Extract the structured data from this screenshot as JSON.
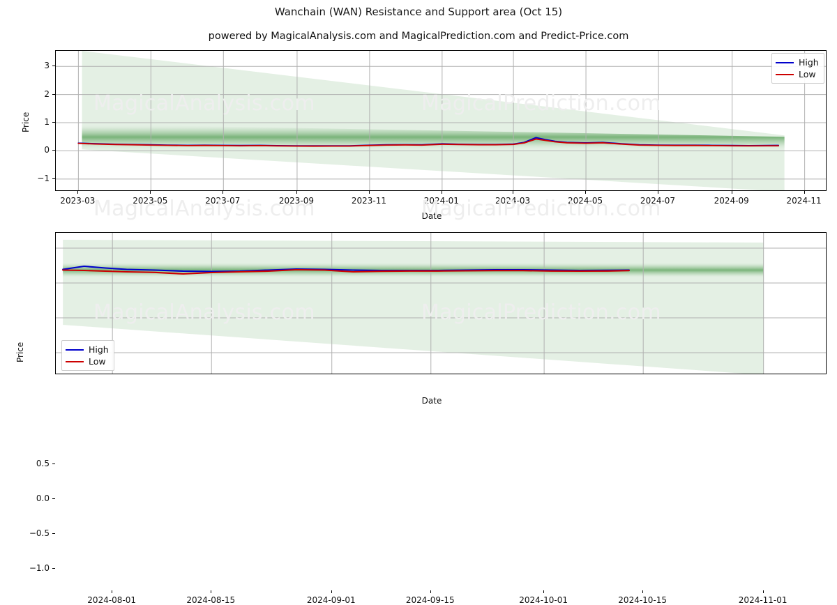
{
  "title": "Wanchain (WAN) Resistance and Support area (Oct 15)",
  "subtitle": "powered by MagicalAnalysis.com and MagicalPrediction.com and Predict-Price.com",
  "watermarks": [
    "MagicalAnalysis.com",
    "MagicalPrediction.com"
  ],
  "colors": {
    "high": "#0000cc",
    "low": "#cc0000",
    "band_core": "#6aab6a",
    "band_outer": "#e3efe3",
    "grid": "#b0b0b0",
    "axis": "#000000",
    "watermark": "#eeeeee"
  },
  "chart_data": [
    {
      "type": "line",
      "id": "top-panel",
      "title": "Wanchain (WAN) Resistance and Support area (Oct 15)",
      "xlabel": "Date",
      "ylabel": "Price",
      "grid": true,
      "legend_position": "upper right",
      "xticks": [
        "2023-03",
        "2023-05",
        "2023-07",
        "2023-09",
        "2023-11",
        "2024-01",
        "2024-03",
        "2024-05",
        "2024-07",
        "2024-09",
        "2024-11"
      ],
      "yticks": [
        3,
        2,
        1,
        0,
        -1
      ],
      "ylim": [
        -1.45,
        3.55
      ],
      "xlim": [
        "2023-02-10",
        "2024-11-20"
      ],
      "legend": [
        "High",
        "Low"
      ],
      "series": [
        {
          "name": "High",
          "color": "#0000cc",
          "x": [
            "2023-03-01",
            "2023-03-15",
            "2023-04-01",
            "2023-04-15",
            "2023-05-01",
            "2023-05-15",
            "2023-06-01",
            "2023-06-15",
            "2023-07-01",
            "2023-07-15",
            "2023-08-01",
            "2023-08-15",
            "2023-09-01",
            "2023-09-15",
            "2023-10-01",
            "2023-10-15",
            "2023-11-01",
            "2023-11-15",
            "2023-12-01",
            "2023-12-15",
            "2024-01-01",
            "2024-01-15",
            "2024-02-01",
            "2024-02-15",
            "2024-03-01",
            "2024-03-10",
            "2024-03-20",
            "2024-03-28",
            "2024-04-05",
            "2024-04-15",
            "2024-05-01",
            "2024-05-15",
            "2024-06-01",
            "2024-06-15",
            "2024-07-01",
            "2024-07-15",
            "2024-08-01",
            "2024-08-15",
            "2024-09-01",
            "2024-09-15",
            "2024-10-01",
            "2024-10-10"
          ],
          "values": [
            0.275,
            0.255,
            0.235,
            0.225,
            0.215,
            0.205,
            0.195,
            0.2,
            0.195,
            0.19,
            0.195,
            0.185,
            0.18,
            0.178,
            0.18,
            0.18,
            0.2,
            0.215,
            0.22,
            0.215,
            0.25,
            0.235,
            0.225,
            0.225,
            0.24,
            0.3,
            0.47,
            0.4,
            0.34,
            0.3,
            0.285,
            0.3,
            0.25,
            0.215,
            0.205,
            0.2,
            0.2,
            0.195,
            0.19,
            0.185,
            0.19,
            0.195
          ]
        },
        {
          "name": "Low",
          "color": "#cc0000",
          "x": [
            "2023-03-01",
            "2023-03-15",
            "2023-04-01",
            "2023-04-15",
            "2023-05-01",
            "2023-05-15",
            "2023-06-01",
            "2023-06-15",
            "2023-07-01",
            "2023-07-15",
            "2023-08-01",
            "2023-08-15",
            "2023-09-01",
            "2023-09-15",
            "2023-10-01",
            "2023-10-15",
            "2023-11-01",
            "2023-11-15",
            "2023-12-01",
            "2023-12-15",
            "2024-01-01",
            "2024-01-15",
            "2024-02-01",
            "2024-02-15",
            "2024-03-01",
            "2024-03-10",
            "2024-03-20",
            "2024-03-28",
            "2024-04-05",
            "2024-04-15",
            "2024-05-01",
            "2024-05-15",
            "2024-06-01",
            "2024-06-15",
            "2024-07-01",
            "2024-07-15",
            "2024-08-01",
            "2024-08-15",
            "2024-09-01",
            "2024-09-15",
            "2024-10-01",
            "2024-10-10"
          ],
          "values": [
            0.265,
            0.245,
            0.225,
            0.215,
            0.205,
            0.195,
            0.185,
            0.19,
            0.185,
            0.18,
            0.185,
            0.175,
            0.17,
            0.168,
            0.17,
            0.17,
            0.19,
            0.205,
            0.21,
            0.205,
            0.235,
            0.225,
            0.215,
            0.215,
            0.228,
            0.28,
            0.42,
            0.37,
            0.32,
            0.285,
            0.27,
            0.285,
            0.238,
            0.205,
            0.195,
            0.19,
            0.19,
            0.185,
            0.18,
            0.175,
            0.18,
            0.18
          ]
        }
      ],
      "bands": {
        "description": "Resistance/support cone widening to the right",
        "outer_start": {
          "upper": 3.55,
          "lower": 0.05
        },
        "outer_end": {
          "upper": 0.55,
          "lower": -1.45
        },
        "core_start": {
          "upper": 0.95,
          "lower": 0.05
        },
        "core_end": {
          "upper": 0.5,
          "lower": 0.02
        }
      }
    },
    {
      "type": "line",
      "id": "bottom-panel",
      "xlabel": "Date",
      "ylabel": "Price",
      "grid": true,
      "legend_position": "lower left",
      "xticks": [
        "2024-08-01",
        "2024-08-15",
        "2024-09-01",
        "2024-09-15",
        "2024-10-01",
        "2024-10-15",
        "2024-11-01"
      ],
      "yticks": [
        0.5,
        0.0,
        -0.5,
        -1.0
      ],
      "ylim": [
        -1.32,
        0.72
      ],
      "xlim": [
        "2024-07-24",
        "2024-11-10"
      ],
      "legend": [
        "High",
        "Low"
      ],
      "series": [
        {
          "name": "High",
          "color": "#0000cc",
          "x": [
            "2024-07-25",
            "2024-07-28",
            "2024-07-31",
            "2024-08-03",
            "2024-08-07",
            "2024-08-11",
            "2024-08-15",
            "2024-08-19",
            "2024-08-23",
            "2024-08-27",
            "2024-08-31",
            "2024-09-04",
            "2024-09-08",
            "2024-09-12",
            "2024-09-16",
            "2024-09-20",
            "2024-09-24",
            "2024-09-28",
            "2024-10-02",
            "2024-10-06",
            "2024-10-10",
            "2024-10-13"
          ],
          "values": [
            0.195,
            0.24,
            0.215,
            0.195,
            0.185,
            0.17,
            0.165,
            0.17,
            0.185,
            0.2,
            0.195,
            0.185,
            0.18,
            0.18,
            0.18,
            0.185,
            0.19,
            0.19,
            0.185,
            0.18,
            0.182,
            0.185
          ]
        },
        {
          "name": "Low",
          "color": "#cc0000",
          "x": [
            "2024-07-25",
            "2024-07-28",
            "2024-07-31",
            "2024-08-03",
            "2024-08-07",
            "2024-08-11",
            "2024-08-15",
            "2024-08-19",
            "2024-08-23",
            "2024-08-27",
            "2024-08-31",
            "2024-09-04",
            "2024-09-08",
            "2024-09-12",
            "2024-09-16",
            "2024-09-20",
            "2024-09-24",
            "2024-09-28",
            "2024-10-02",
            "2024-10-06",
            "2024-10-10",
            "2024-10-13"
          ],
          "values": [
            0.185,
            0.18,
            0.17,
            0.16,
            0.152,
            0.13,
            0.15,
            0.16,
            0.17,
            0.19,
            0.185,
            0.16,
            0.168,
            0.172,
            0.172,
            0.175,
            0.178,
            0.178,
            0.172,
            0.17,
            0.172,
            0.178
          ]
        }
      ],
      "bands": {
        "description": "Resistance/support band roughly flat, outer cone widening downward",
        "outer_start": {
          "upper": 0.62,
          "lower": -0.6
        },
        "outer_end": {
          "upper": 0.58,
          "lower": -1.32
        },
        "core_start": {
          "upper": 0.3,
          "lower": 0.07
        },
        "core_end": {
          "upper": 0.3,
          "lower": 0.07
        }
      }
    }
  ]
}
